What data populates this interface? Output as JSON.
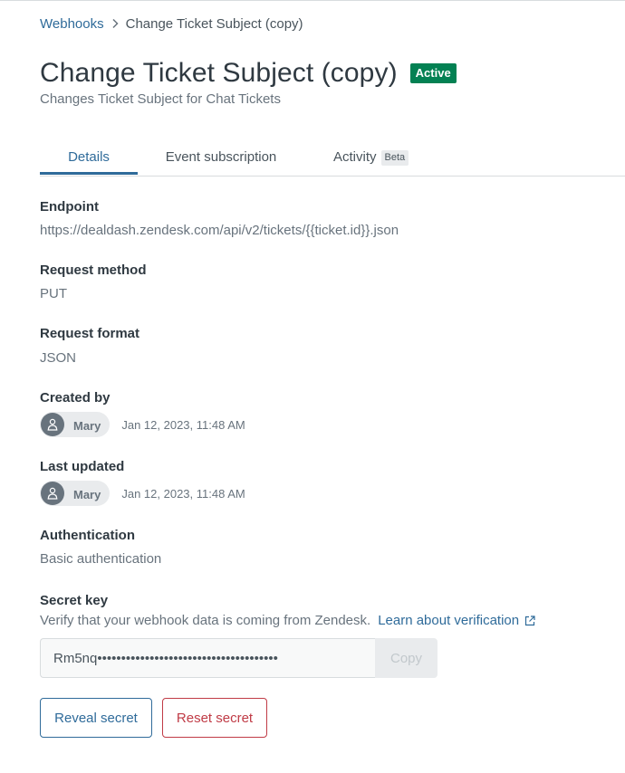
{
  "breadcrumb": {
    "parent": "Webhooks",
    "current": "Change Ticket Subject (copy)"
  },
  "header": {
    "title": "Change Ticket Subject (copy)",
    "status_badge": "Active",
    "subtitle": "Changes Ticket Subject for Chat Tickets"
  },
  "tabs": {
    "details": "Details",
    "event_subscription": "Event subscription",
    "activity": "Activity",
    "activity_badge": "Beta"
  },
  "fields": {
    "endpoint_label": "Endpoint",
    "endpoint_value": "https://dealdash.zendesk.com/api/v2/tickets/{{ticket.id}}.json",
    "method_label": "Request method",
    "method_value": "PUT",
    "format_label": "Request format",
    "format_value": "JSON",
    "created_label": "Created by",
    "created_user": "Mary",
    "created_date": "Jan 12, 2023, 11:48 AM",
    "updated_label": "Last updated",
    "updated_user": "Mary",
    "updated_date": "Jan 12, 2023, 11:48 AM",
    "auth_label": "Authentication",
    "auth_value": "Basic authentication"
  },
  "secret": {
    "label": "Secret key",
    "hint": "Verify that your webhook data is coming from Zendesk.",
    "link": "Learn about verification",
    "masked_value": "Rm5nq••••••••••••••••••••••••••••••••••••••",
    "copy_label": "Copy",
    "reveal_label": "Reveal secret",
    "reset_label": "Reset secret"
  },
  "colors": {
    "accent": "#2f6b9a",
    "active_badge": "#038153",
    "danger": "#c03b46"
  },
  "icons": {
    "breadcrumb_separator": "chevron-right-icon",
    "avatar": "user-icon",
    "external": "external-link-icon"
  }
}
